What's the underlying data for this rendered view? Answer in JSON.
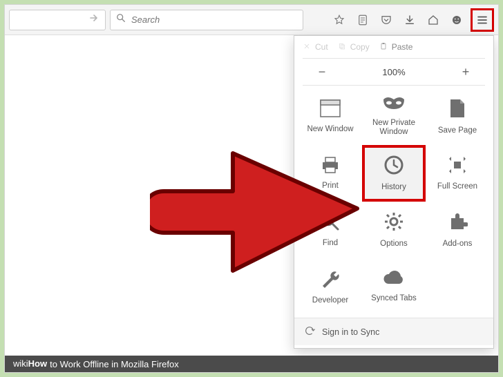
{
  "toolbar": {
    "search_placeholder": "Search"
  },
  "panel": {
    "edit": {
      "cut": "Cut",
      "copy": "Copy",
      "paste": "Paste"
    },
    "zoom": {
      "minus": "−",
      "level": "100%",
      "plus": "+"
    },
    "items": [
      {
        "label": "New Window"
      },
      {
        "label": "New Private\nWindow"
      },
      {
        "label": "Save Page"
      },
      {
        "label": "Print"
      },
      {
        "label": "History"
      },
      {
        "label": "Full Screen"
      },
      {
        "label": "Find"
      },
      {
        "label": "Options"
      },
      {
        "label": "Add-ons"
      },
      {
        "label": "Developer"
      },
      {
        "label": "Synced Tabs"
      }
    ],
    "signin": "Sign in to Sync"
  },
  "caption": {
    "prefix_plain": "wiki",
    "prefix_bold": "How",
    "title": "to Work Offline in Mozilla Firefox"
  }
}
